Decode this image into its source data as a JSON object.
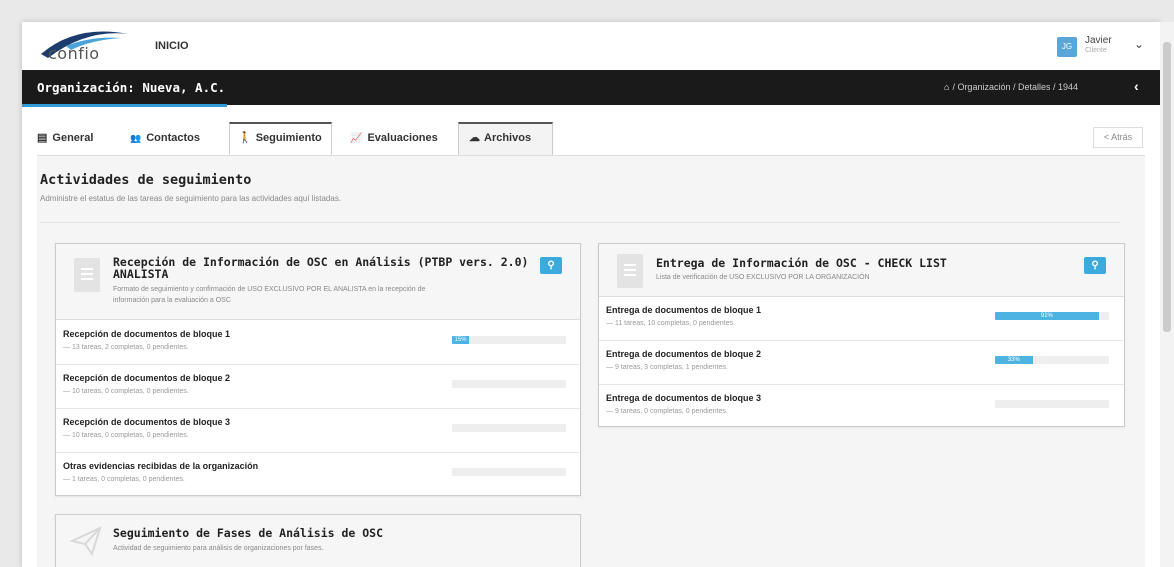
{
  "app": {
    "logo_text": "confio",
    "nav_home": "INICIO",
    "user": {
      "initials": "JG",
      "name": "Javier",
      "role": "Cliente"
    }
  },
  "header": {
    "title": "Organización: Nueva, A.C.",
    "breadcrumb": "/ Organización / Detalles / 1944"
  },
  "tabs": [
    {
      "label": "General",
      "icon": "building-icon",
      "glyph": "▤"
    },
    {
      "label": "Contactos",
      "icon": "users-icon",
      "glyph": "👥"
    },
    {
      "label": "Seguimiento",
      "icon": "walking-icon",
      "glyph": "🚶"
    },
    {
      "label": "Evaluaciones",
      "icon": "chart-icon",
      "glyph": "📈"
    },
    {
      "label": "Archivos",
      "icon": "cloud-icon",
      "glyph": "☁"
    }
  ],
  "back_label": "< Atrás",
  "section": {
    "title": "Actividades de seguimiento",
    "subtitle": "Administre el estatus de las tareas de seguimiento para las actividades aquí listadas."
  },
  "cards": {
    "c1": {
      "title_line1": "Recepción de Información de OSC en Análisis (PTBP vers. 2.0)",
      "title_line2": "ANALISTA",
      "desc_line1": "Formato de seguimiento y confirmación de USO EXCLUSIVO POR EL ANALISTA en la recepción de",
      "desc_line2": "información para la evaluación a OSC",
      "rows": [
        {
          "title": "Recepción de documentos de bloque 1",
          "stats": "— 13 tareas, 2 completas, 0 pendientes.",
          "progress": 15,
          "progress_label": "15%"
        },
        {
          "title": "Recepción de documentos de bloque 2",
          "stats": "— 10 tareas, 0 completas, 0 pendientes.",
          "progress": 0,
          "progress_label": ""
        },
        {
          "title": "Recepción de documentos de bloque 3",
          "stats": "— 10 tareas, 0 completas, 0 pendientes.",
          "progress": 0,
          "progress_label": ""
        },
        {
          "title": "Otras evidencias recibidas de la organización",
          "stats": "— 1 tareas, 0 completas, 0 pendientes.",
          "progress": 0,
          "progress_label": ""
        }
      ]
    },
    "c2": {
      "title": "Entrega de Información de OSC - CHECK LIST",
      "desc": "Lista de verificación de USO EXCLUSIVO POR LA ORGANIZACIÓN",
      "rows": [
        {
          "title": "Entrega de documentos de bloque 1",
          "stats": "— 11 tareas, 10 completas, 0 pendientes.",
          "progress": 91,
          "progress_label": "91%"
        },
        {
          "title": "Entrega de documentos de bloque 2",
          "stats": "— 9 tareas, 3 completas, 1 pendientes.",
          "progress": 33,
          "progress_label": "33%"
        },
        {
          "title": "Entrega de documentos de bloque 3",
          "stats": "— 9 tareas, 0 completas, 0 pendientes.",
          "progress": 0,
          "progress_label": ""
        }
      ]
    },
    "c3": {
      "title": "Seguimiento de Fases de Análisis de OSC",
      "desc": "Actividad de seguimiento para análisis de organizaciones por fases."
    }
  },
  "colors": {
    "accent": "#2e9bd6",
    "progress": "#4db3e0",
    "dark_header": "#1a1a1a"
  }
}
